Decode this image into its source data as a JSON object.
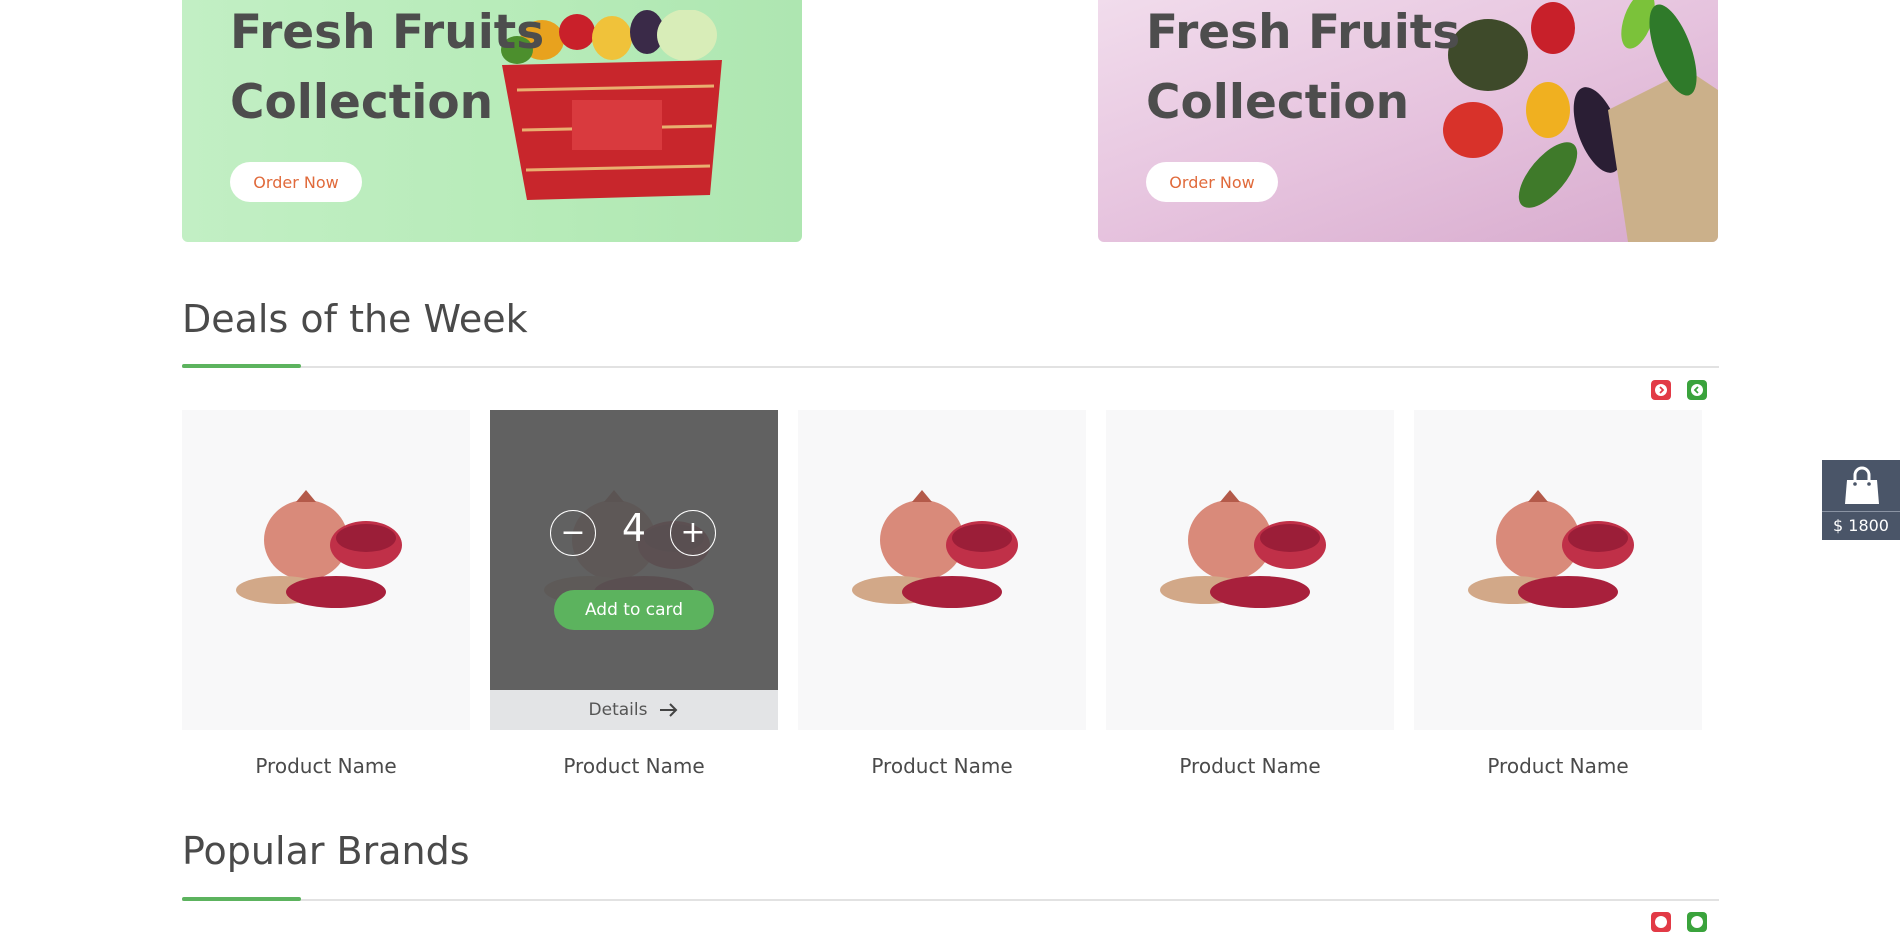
{
  "banners": [
    {
      "title_line1": "Fresh Fruits",
      "title_line2": "Collection",
      "button_label": "Order Now"
    },
    {
      "title_line1": "Fresh Fruits",
      "title_line2": "Collection",
      "button_label": "Order Now"
    }
  ],
  "deals": {
    "title": "Deals of the Week",
    "products": [
      {
        "name": "Product Name"
      },
      {
        "name": "Product Name",
        "hovered": true,
        "quantity": "4",
        "minus_label": "−",
        "plus_label": "+",
        "add_label": "Add to card",
        "details_label": "Details"
      },
      {
        "name": "Product Name"
      },
      {
        "name": "Product Name"
      },
      {
        "name": "Product Name"
      }
    ]
  },
  "brands": {
    "title": "Popular Brands"
  },
  "cart": {
    "total": "$ 1800",
    "icon": "shopping-bag-icon"
  },
  "colors": {
    "accent_green": "#5cb35e",
    "prev_red": "#e23a46",
    "next_green": "#3aa33c"
  }
}
